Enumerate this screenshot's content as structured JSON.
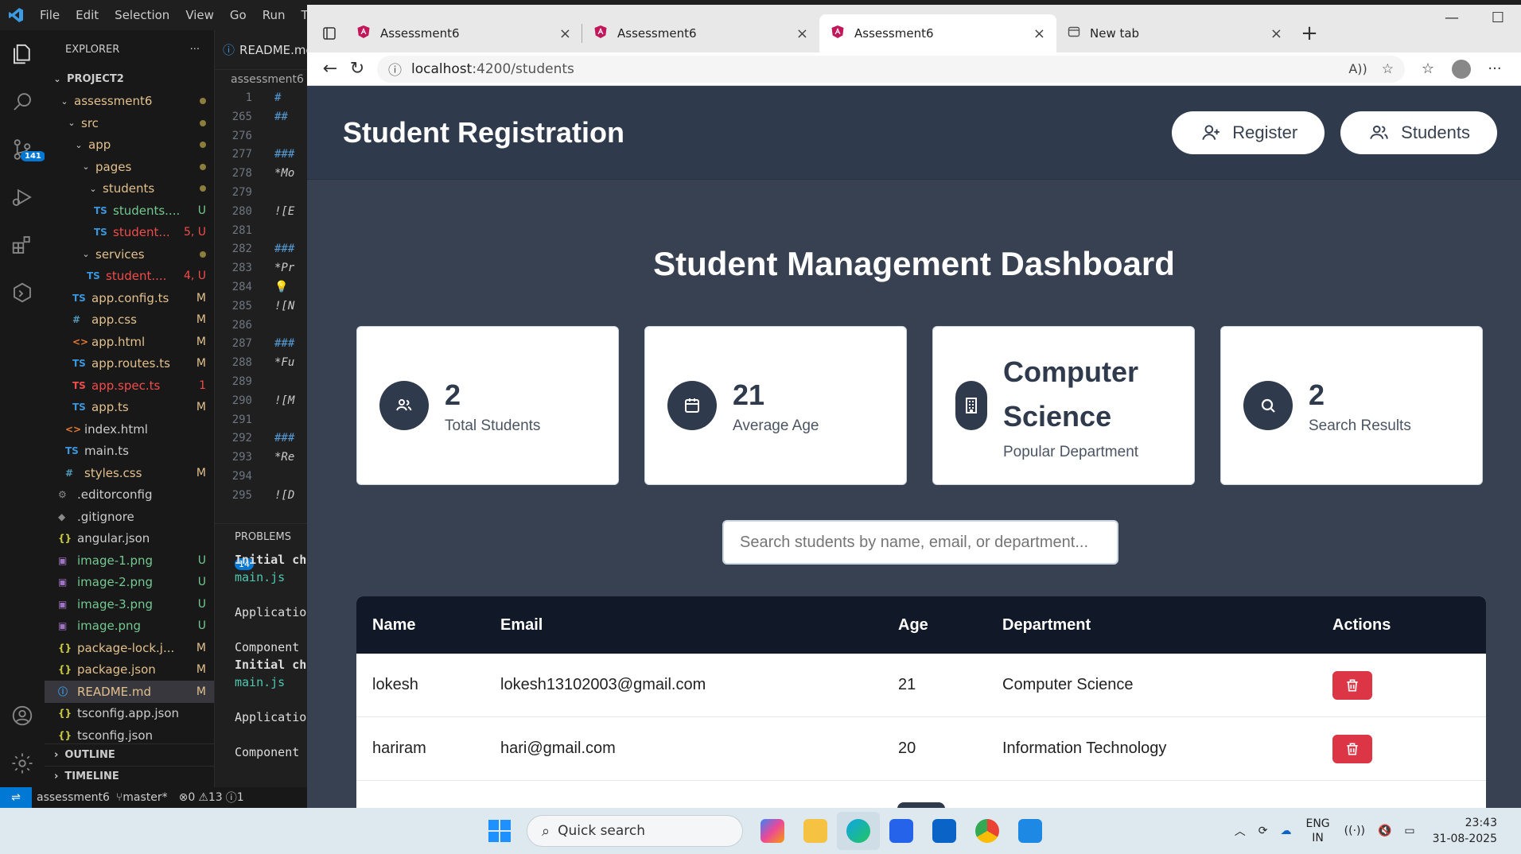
{
  "vscode": {
    "menu": [
      "File",
      "Edit",
      "Selection",
      "View",
      "Go",
      "Run",
      "Te"
    ],
    "explorer_title": "EXPLORER",
    "project": "PROJECT2",
    "scm_badge": "141",
    "tree": [
      {
        "name": "assessment6",
        "kind": "folder",
        "status": "dot"
      },
      {
        "name": "src",
        "kind": "folder",
        "status": "dot"
      },
      {
        "name": "app",
        "kind": "folder",
        "status": "dot"
      },
      {
        "name": "pages",
        "kind": "folder",
        "status": "dot"
      },
      {
        "name": "students",
        "kind": "folder",
        "status": "dot"
      },
      {
        "name": "students....",
        "kind": "ts",
        "status": "U"
      },
      {
        "name": "student...",
        "kind": "ts",
        "status": "5, U"
      },
      {
        "name": "services",
        "kind": "folder",
        "status": "dot"
      },
      {
        "name": "student....",
        "kind": "ts",
        "status": "4, U"
      },
      {
        "name": "app.config.ts",
        "kind": "ts",
        "status": "M"
      },
      {
        "name": "app.css",
        "kind": "css",
        "status": "M"
      },
      {
        "name": "app.html",
        "kind": "html",
        "status": "M"
      },
      {
        "name": "app.routes.ts",
        "kind": "ts",
        "status": "M"
      },
      {
        "name": "app.spec.ts",
        "kind": "ts-err",
        "status": "1"
      },
      {
        "name": "app.ts",
        "kind": "ts",
        "status": "M"
      },
      {
        "name": "index.html",
        "kind": "html",
        "status": ""
      },
      {
        "name": "main.ts",
        "kind": "ts",
        "status": ""
      },
      {
        "name": "styles.css",
        "kind": "css",
        "status": "M"
      },
      {
        "name": ".editorconfig",
        "kind": "gear",
        "status": ""
      },
      {
        "name": ".gitignore",
        "kind": "git",
        "status": ""
      },
      {
        "name": "angular.json",
        "kind": "json",
        "status": ""
      },
      {
        "name": "image-1.png",
        "kind": "img",
        "status": "U"
      },
      {
        "name": "image-2.png",
        "kind": "img",
        "status": "U"
      },
      {
        "name": "image-3.png",
        "kind": "img",
        "status": "U"
      },
      {
        "name": "image.png",
        "kind": "img",
        "status": "U"
      },
      {
        "name": "package-lock.j...",
        "kind": "json",
        "status": "M"
      },
      {
        "name": "package.json",
        "kind": "json",
        "status": "M"
      },
      {
        "name": "README.md",
        "kind": "info",
        "status": "M"
      },
      {
        "name": "tsconfig.app.json",
        "kind": "json",
        "status": ""
      },
      {
        "name": "tsconfig.json",
        "kind": "json",
        "status": ""
      }
    ],
    "outline": "OUTLINE",
    "timeline": "TIMELINE",
    "editor_tab": "README.md",
    "breadcrumb": "assessment6",
    "code_lines": [
      {
        "ln": "1",
        "tx": "#"
      },
      {
        "ln": "265",
        "tx": "##"
      },
      {
        "ln": "276",
        "tx": ""
      },
      {
        "ln": "277",
        "tx": "###"
      },
      {
        "ln": "278",
        "tx": "*Mo"
      },
      {
        "ln": "279",
        "tx": ""
      },
      {
        "ln": "280",
        "tx": "![E"
      },
      {
        "ln": "281",
        "tx": ""
      },
      {
        "ln": "282",
        "tx": "###"
      },
      {
        "ln": "283",
        "tx": "*Pr"
      },
      {
        "ln": "284",
        "tx": "💡"
      },
      {
        "ln": "285",
        "tx": "![N"
      },
      {
        "ln": "286",
        "tx": ""
      },
      {
        "ln": "287",
        "tx": "###"
      },
      {
        "ln": "288",
        "tx": "*Fu"
      },
      {
        "ln": "289",
        "tx": ""
      },
      {
        "ln": "290",
        "tx": "![M"
      },
      {
        "ln": "291",
        "tx": ""
      },
      {
        "ln": "292",
        "tx": "###"
      },
      {
        "ln": "293",
        "tx": "*Re"
      },
      {
        "ln": "294",
        "tx": ""
      },
      {
        "ln": "295",
        "tx": "![D"
      }
    ],
    "panel_title": "PROBLEMS",
    "panel_badge": "14",
    "panel_lines": [
      "Initial ch",
      "main.js",
      "",
      "Applicatio",
      "",
      "Component",
      "Initial ch",
      "main.js",
      "",
      "Applicatio",
      "",
      "Component"
    ],
    "status": {
      "branch_repo": "assessment6",
      "branch": "master*",
      "errors": "0",
      "warnings": "13",
      "info": "1"
    }
  },
  "browser": {
    "tabs": [
      {
        "title": "Assessment6",
        "active": false
      },
      {
        "title": "Assessment6",
        "active": false
      },
      {
        "title": "Assessment6",
        "active": true
      },
      {
        "title": "New tab",
        "active": false
      }
    ],
    "url_host": "localhost",
    "url_path": ":4200/students"
  },
  "app": {
    "title": "Student Registration",
    "nav": {
      "register": "Register",
      "students": "Students"
    },
    "dashboard_title": "Student Management Dashboard",
    "cards": [
      {
        "value": "2",
        "label": "Total Students",
        "icon": "users-icon"
      },
      {
        "value": "21",
        "label": "Average Age",
        "icon": "calendar-icon"
      },
      {
        "value": "Computer Science",
        "label": "Popular Department",
        "icon": "building-icon"
      },
      {
        "value": "2",
        "label": "Search Results",
        "icon": "search-icon"
      }
    ],
    "search_placeholder": "Search students by name, email, or department...",
    "table": {
      "headers": [
        "Name",
        "Email",
        "Age",
        "Department",
        "Actions"
      ],
      "rows": [
        {
          "name": "lokesh",
          "email": "lokesh13102003@gmail.com",
          "age": "21",
          "department": "Computer Science"
        },
        {
          "name": "hariram",
          "email": "hari@gmail.com",
          "age": "20",
          "department": "Information Technology"
        }
      ]
    }
  },
  "taskbar": {
    "search": "Quick search",
    "lang1": "ENG",
    "lang2": "IN",
    "time": "23:43",
    "date": "31-08-2025"
  }
}
